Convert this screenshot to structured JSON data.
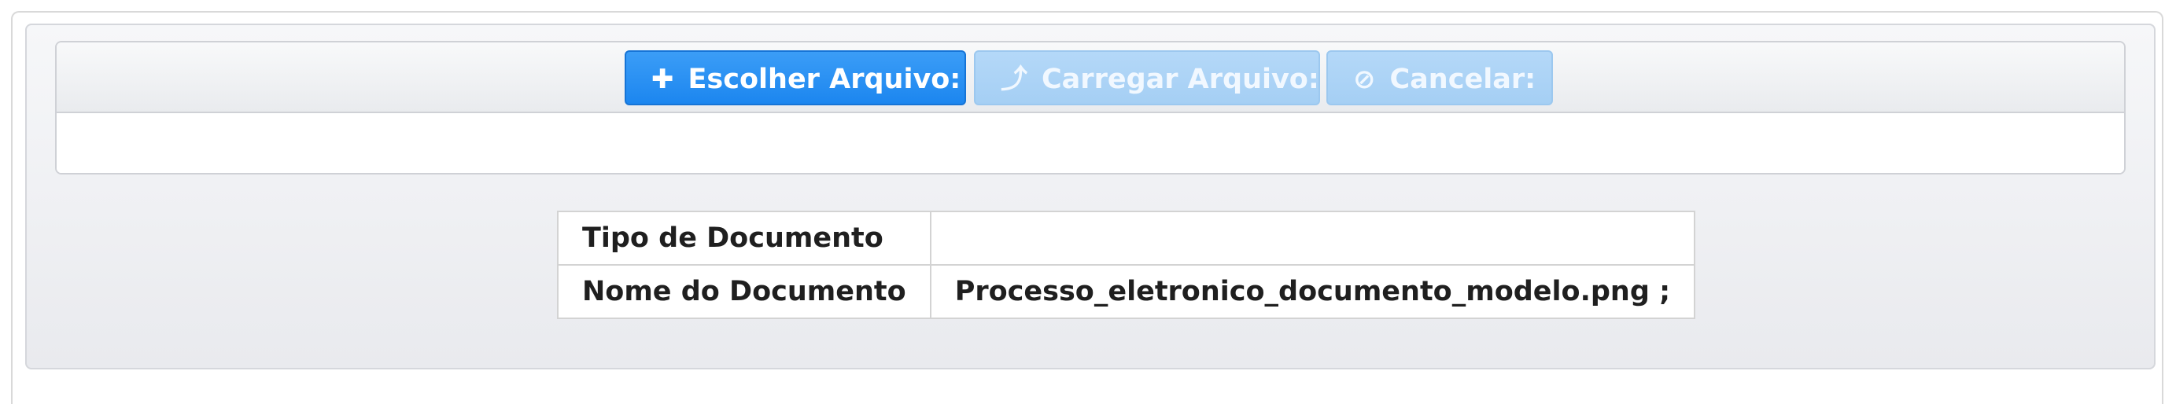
{
  "upload": {
    "buttons": {
      "choose": {
        "label": "Escolher Arquivo:",
        "icon": "plus-icon",
        "glyph": "✚"
      },
      "upload": {
        "label": "Carregar Arquivo:",
        "icon": "upload-arrow-icon",
        "glyph": "⤴"
      },
      "cancel": {
        "label": "Cancelar:",
        "icon": "cancel-circle-icon",
        "glyph": "⊘"
      }
    }
  },
  "document_info": {
    "rows": [
      {
        "label": "Tipo de Documento",
        "value": ""
      },
      {
        "label": "Nome do Documento",
        "value": "Processo_eletronico_documento_modelo.png ;"
      }
    ]
  },
  "colors": {
    "primary_button": "#2590f2",
    "disabled_button": "#aed3f6",
    "panel_background": "#eceef1",
    "border": "#d3d3d3"
  }
}
